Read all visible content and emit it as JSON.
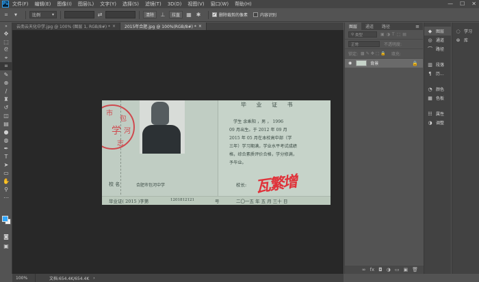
{
  "app": {
    "logo": "Ps"
  },
  "menu": [
    "文件(F)",
    "编辑(E)",
    "图像(I)",
    "图层(L)",
    "文字(Y)",
    "选择(S)",
    "滤镜(T)",
    "3D(D)",
    "视图(V)",
    "窗口(W)",
    "帮助(H)"
  ],
  "window_controls": {
    "minimize": "—",
    "maximize": "☐",
    "close": "✕"
  },
  "options": {
    "ratio_select": "比例",
    "clear_button": "清除",
    "straighten_button": "拉直",
    "delete_cropped_label": "删除裁剪的像素",
    "delete_cropped_checked": true,
    "content_aware_label": "内容识别",
    "content_aware_checked": false
  },
  "tabs": [
    {
      "label": "云南云天化中学.jpg @ 100% (图层 1, RGB/8#) *",
      "close": "×",
      "active": false
    },
    {
      "label": "2015年合肥.jpg @ 100%(RGB/8#) *",
      "close": "×",
      "active": true
    }
  ],
  "document": {
    "title": "毕 业 证 书",
    "stamp_chars": [
      "市",
      "包",
      "河",
      "学",
      "志"
    ],
    "lines": [
      "学生 余乘阳 ，男 ，   1996",
      "09 月出生。于    2012  年  09  月",
      "2015 年  05 月在本校高中部（学",
      "三年）学习期满，学业水平考试成绩",
      "格，综合素质评价合格，学分修满，",
      "予毕业。"
    ],
    "principal_label": "校长:",
    "signature": "瓦繁增",
    "school_label": "校  名",
    "school_name": "合肥市包河中学",
    "cert_no": "毕业证( 2015 )字第",
    "cert_no_num": "1201812121",
    "cert_no_suffix": "号",
    "date": "二〇一五 年  五  月  三十 日"
  },
  "status": {
    "zoom": "100%",
    "doc_size": "文档:654.4K/654.4K",
    "arrow": "›"
  },
  "layers_panel": {
    "tabs": [
      "图层",
      "通道",
      "路径"
    ],
    "filter_placeholder": "类型",
    "blend_mode": "正常",
    "opacity_label": "不透明度:",
    "lock_label": "锁定:",
    "fill_label": "填充:",
    "layer_name": "背景",
    "visibility_icon": "◉",
    "lock_icon": "🔒",
    "footer_icons": [
      "∞",
      "fx",
      "◘",
      "◑",
      "▭",
      "▣",
      "🗑"
    ]
  },
  "icon_column": [
    {
      "icon": "◆",
      "label": "图层"
    },
    {
      "icon": "◎",
      "label": "通道"
    },
    {
      "icon": "⌒",
      "label": "路径"
    },
    {
      "icon": "▥",
      "label": "段落"
    },
    {
      "icon": "¶",
      "label": "历..."
    },
    {
      "icon": "◔",
      "label": "颜色"
    },
    {
      "icon": "▦",
      "label": "色板"
    },
    {
      "icon": "☷",
      "label": "属性"
    },
    {
      "icon": "◑",
      "label": "调整"
    }
  ],
  "far_column": [
    {
      "icon": "◌",
      "label": "学习"
    },
    {
      "icon": "⊛",
      "label": "库"
    }
  ]
}
